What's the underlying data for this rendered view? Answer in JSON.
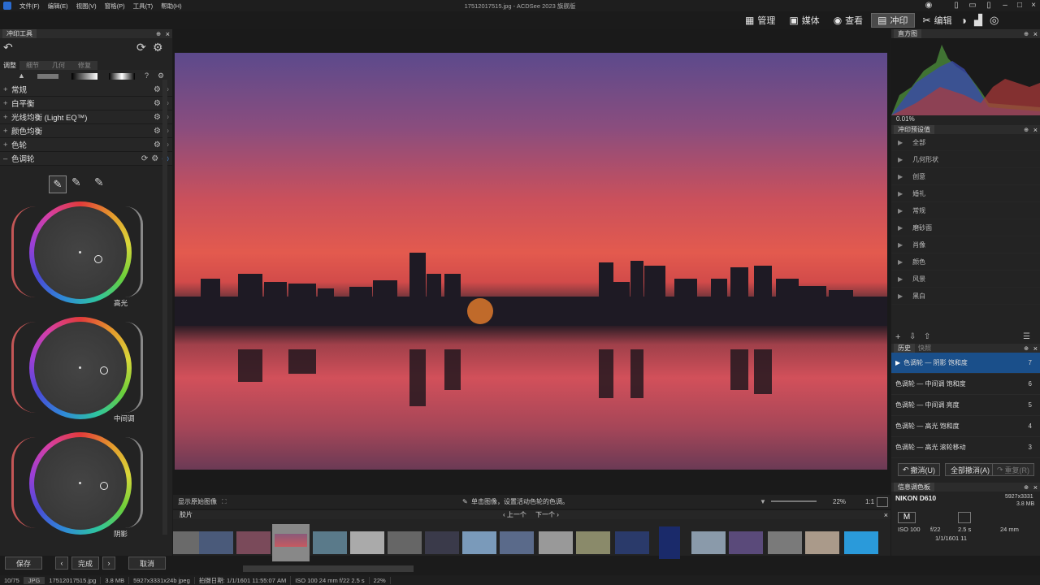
{
  "titlebar": {
    "menus": [
      "文件(F)",
      "编辑(E)",
      "视图(V)",
      "窗格(P)",
      "工具(T)",
      "帮助(H)"
    ],
    "title": "17512017515.jpg - ACDSee 2023 旗舰版"
  },
  "modes": [
    {
      "label": "管理",
      "icon": "grid-icon"
    },
    {
      "label": "媒体",
      "icon": "media-icon"
    },
    {
      "label": "查看",
      "icon": "eye-icon"
    },
    {
      "label": "冲印",
      "icon": "develop-icon"
    },
    {
      "label": "编辑",
      "icon": "edit-icon"
    }
  ],
  "left": {
    "panel_title": "冲印工具",
    "tabs": [
      "调整",
      "细节",
      "几何",
      "修复"
    ],
    "sections": [
      "常规",
      "白平衡",
      "光线均衡 (Light EQ™)",
      "颜色均衡",
      "色轮",
      "色调轮"
    ],
    "wheels": [
      "高光",
      "中间调",
      "阴影"
    ],
    "buttons": {
      "save": "保存",
      "done": "完成",
      "cancel": "取消"
    }
  },
  "center": {
    "show_original": "显示原始图像",
    "hint": "单击图像，设置活动色轮的色调。",
    "zoom": "22%",
    "ratio": "1:1"
  },
  "film": {
    "title": "胶片",
    "prev": "上一个",
    "next": "下一个"
  },
  "right": {
    "histogram_title": "直方图",
    "clip": "0.01%",
    "presets_title": "冲印预设值",
    "presets": [
      "全部",
      "几何形状",
      "创意",
      "婚礼",
      "常规",
      "磨砂面",
      "肖像",
      "颜色",
      "风景",
      "黑白"
    ],
    "history_tabs": [
      "历史",
      "快照"
    ],
    "history": [
      {
        "label": "色调轮 — 阴影 饱和度",
        "n": "7"
      },
      {
        "label": "色调轮 — 中间调 饱和度",
        "n": "6"
      },
      {
        "label": "色调轮 — 中间调 亮度",
        "n": "5"
      },
      {
        "label": "色调轮 — 高光 饱和度",
        "n": "4"
      },
      {
        "label": "色调轮 — 高光 滚轮移动",
        "n": "3"
      }
    ],
    "undo": "撤消(U)",
    "undo_all": "全部撤消(A)",
    "redo": "重复(R)",
    "info_title": "信息调色板",
    "camera": "NIKON D610",
    "dims": "5927x3331",
    "size": "3.8 MB",
    "mode": "M",
    "iso": "ISO 100",
    "fstop": "f/22",
    "shutter": "2.5 s",
    "focal": "24 mm",
    "date": "1/1/1601 11"
  },
  "status": [
    "10/75",
    "JPG",
    "17512017515.jpg",
    "3.8 MB",
    "5927x3331x24b jpeg",
    "拍摄日期: 1/1/1601 11:55:07 AM",
    "ISO 100  24 mm  f/22  2.5 s",
    "22%"
  ]
}
